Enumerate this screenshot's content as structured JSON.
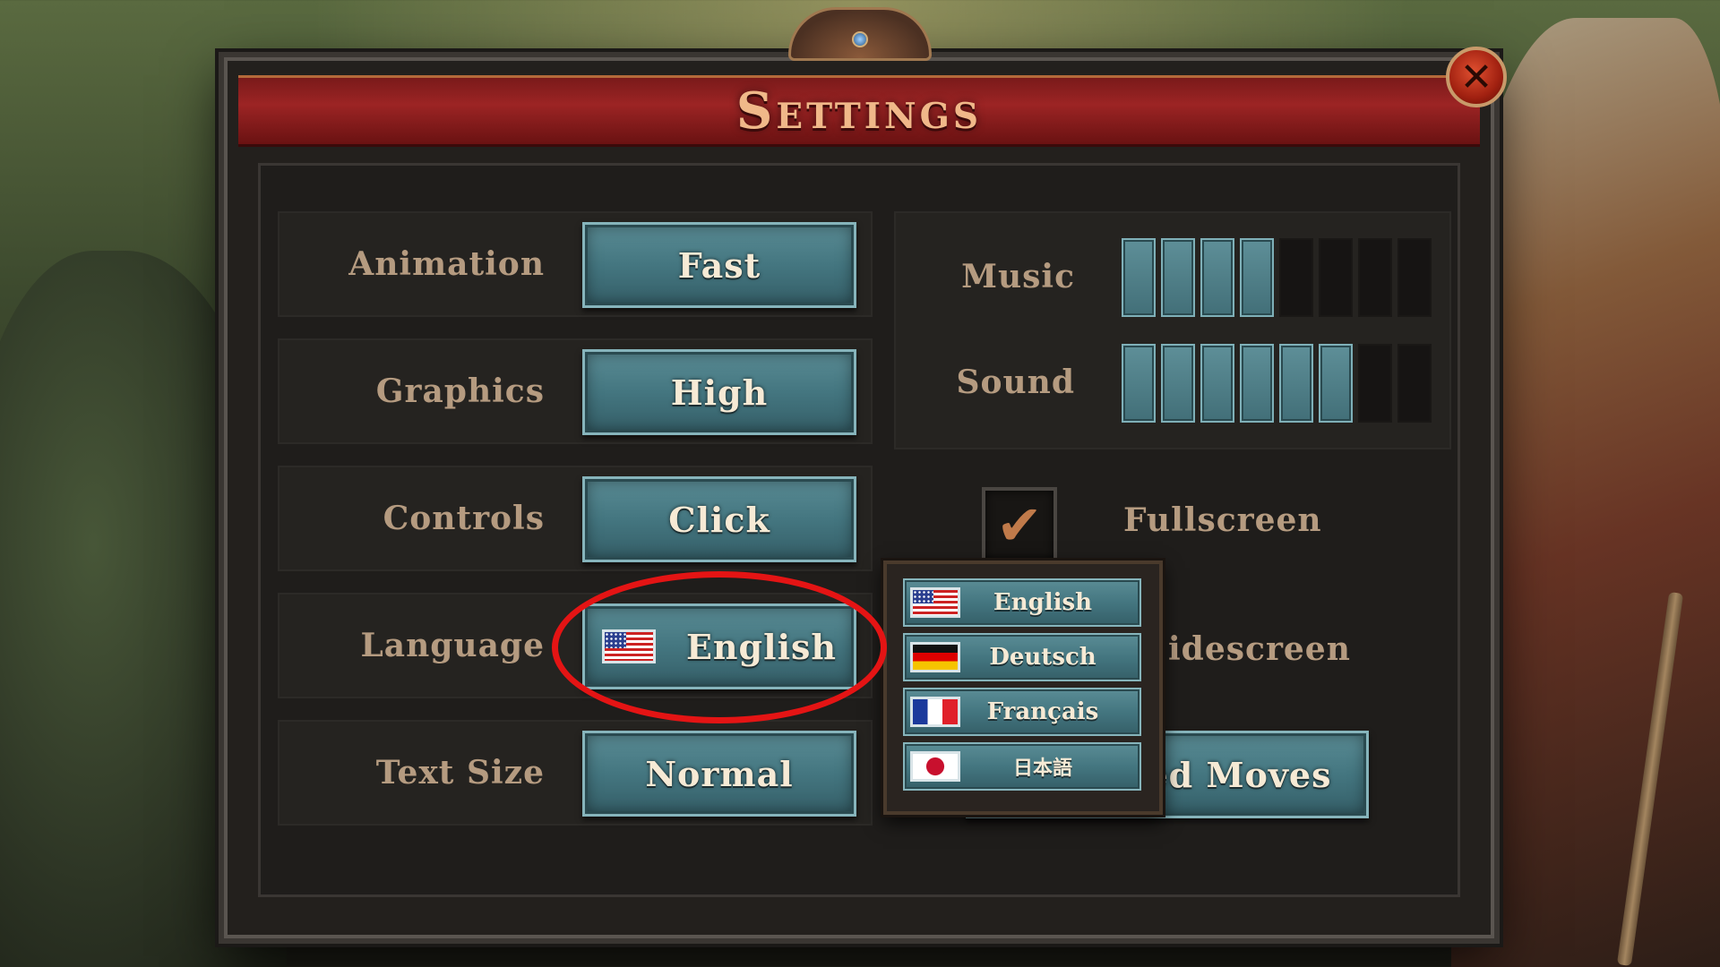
{
  "window": {
    "title": "Settings",
    "close_label": "✕"
  },
  "settings": [
    {
      "label": "Animation",
      "value": "Fast"
    },
    {
      "label": "Graphics",
      "value": "High"
    },
    {
      "label": "Controls",
      "value": "Click"
    },
    {
      "label": "Language",
      "value": "English",
      "flag": "us-flag-icon"
    },
    {
      "label": "Text Size",
      "value": "Normal"
    }
  ],
  "audio": {
    "music": {
      "label": "Music",
      "level": 4,
      "max": 8
    },
    "sound": {
      "label": "Sound",
      "level": 6,
      "max": 8
    }
  },
  "options": {
    "fullscreen": {
      "label": "Fullscreen",
      "checked": true,
      "check_glyph": "✔"
    },
    "widescreen": {
      "label": "idescreen"
    },
    "moves_button": {
      "label": "ed Moves"
    }
  },
  "language_dropdown": {
    "items": [
      {
        "label": "English",
        "flag": "us-flag-icon"
      },
      {
        "label": "Deutsch",
        "flag": "de-flag-icon"
      },
      {
        "label": "Français",
        "flag": "fr-flag-icon"
      },
      {
        "label": "日本語",
        "flag": "jp-flag-icon"
      }
    ]
  },
  "colors": {
    "title": "#f0b889",
    "banner": "#9c2424",
    "button_teal": "#447680",
    "label": "#b59b80",
    "highlight": "#e41414",
    "check": "#c07a4a"
  }
}
